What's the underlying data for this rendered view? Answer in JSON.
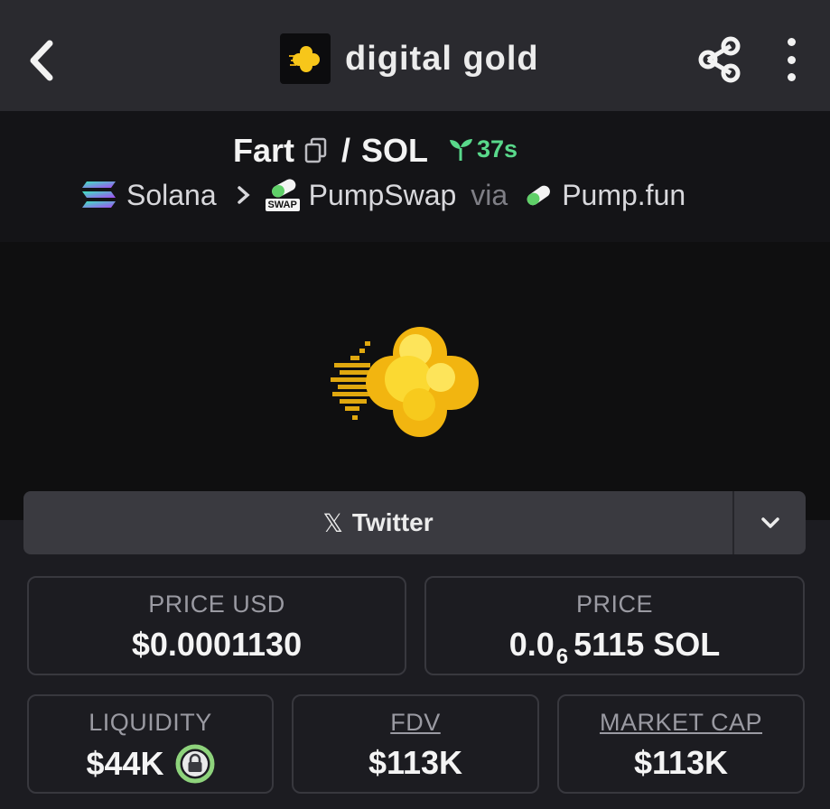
{
  "header": {
    "title": "digital gold",
    "back_icon": "chevron-left-icon",
    "share_icon": "share-icon",
    "more_icon": "more-vertical-icon"
  },
  "pair": {
    "base": "Fart",
    "separator": "/",
    "quote": "SOL",
    "age": "37s",
    "age_color": "#59d98b"
  },
  "chain": {
    "network": "Solana",
    "dex": "PumpSwap",
    "dex_badge": "SWAP",
    "via": "via",
    "source": "Pump.fun"
  },
  "socials": {
    "twitter_label": "Twitter"
  },
  "stats": {
    "price_usd_label": "PRICE USD",
    "price_usd_value": "$0.0001130",
    "price_label": "PRICE",
    "price_prefix": "0.0",
    "price_zero_count": "6",
    "price_digits": "5115 SOL",
    "liquidity_label": "LIQUIDITY",
    "liquidity_value": "$44K",
    "fdv_label": "FDV",
    "fdv_value": "$113K",
    "market_cap_label": "MARKET CAP",
    "market_cap_value": "$113K"
  },
  "colors": {
    "background": "#1c1c21",
    "header": "#2a2a2f",
    "token_yellow": "#f7c61a",
    "lock_green": "#8ed37c"
  }
}
